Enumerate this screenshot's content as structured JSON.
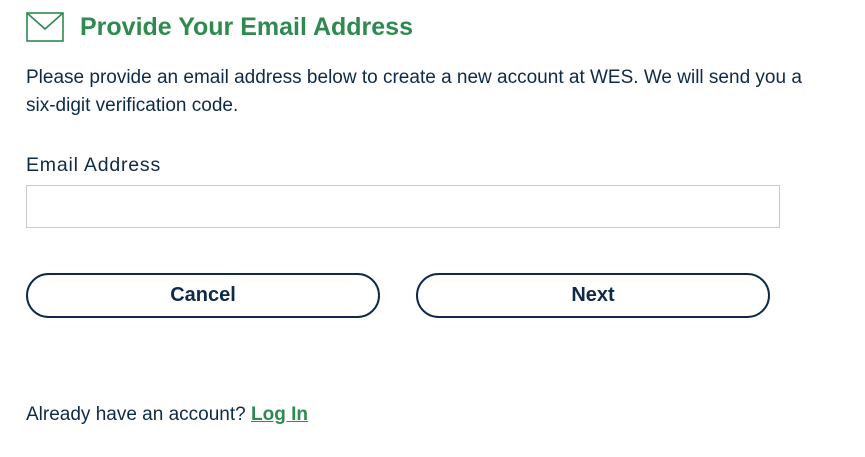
{
  "header": {
    "icon": "envelope-icon",
    "title": "Provide Your Email Address"
  },
  "intro": {
    "text": "Please provide an email address below to create a new account at WES. We will send you a six-digit verification code."
  },
  "email_field": {
    "label": "Email Address",
    "value": "",
    "placeholder": ""
  },
  "buttons": {
    "cancel_label": "Cancel",
    "next_label": "Next"
  },
  "footer": {
    "prompt": "Already have an account?",
    "login_label": "Log In"
  },
  "colors": {
    "title_green": "#2e8a4e",
    "text_navy": "#0e2a47",
    "input_border": "#c9c9c9"
  }
}
